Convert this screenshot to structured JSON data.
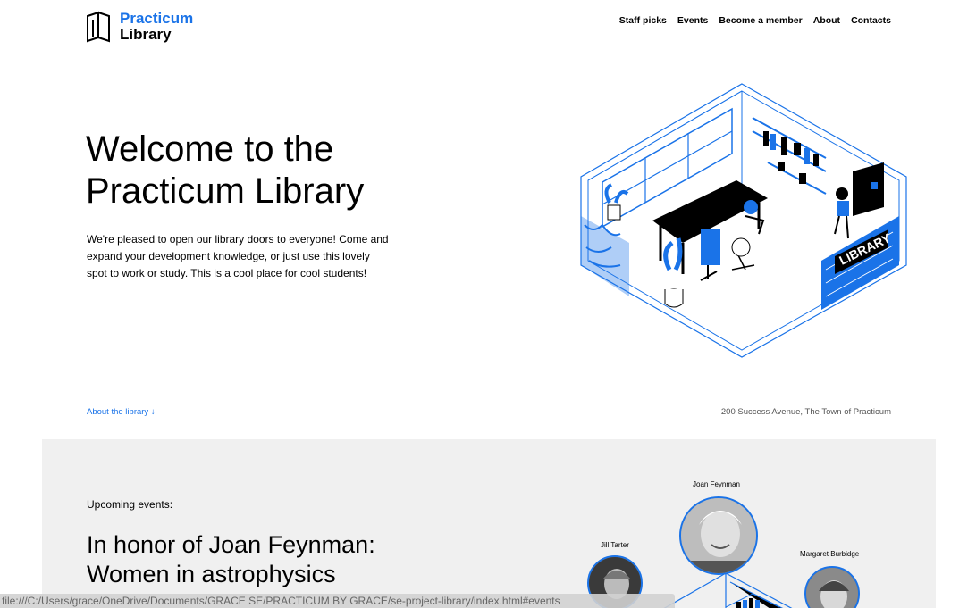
{
  "header": {
    "logo_line1": "Practicum",
    "logo_line2": "Library",
    "nav": [
      "Staff picks",
      "Events",
      "Become a member",
      "About",
      "Contacts"
    ]
  },
  "hero": {
    "title": "Welcome to the Practicum Library",
    "text": "We're pleased to open our library doors to everyone! Come and expand your development knowledge, or just use this lovely spot to work or study. This is a cool place for cool students!",
    "illustration_sign": "LIBRARY"
  },
  "footer_row": {
    "about_link": "About the library ↓",
    "address": "200 Success Avenue, The Town of Practicum"
  },
  "events": {
    "label": "Upcoming events:",
    "title": "In honor of Joan Feynman: Women in astrophysics",
    "people": [
      "Joan Feynman",
      "Jill Tarter",
      "Margaret Burbidge"
    ]
  },
  "status_bar": {
    "url": "file:///C:/Users/grace/OneDrive/Documents/GRACE SE/PRACTICUM BY GRACE/se-project-library/index.html#events"
  },
  "colors": {
    "accent": "#1a73e8",
    "events_bg": "#f0f0f0"
  }
}
